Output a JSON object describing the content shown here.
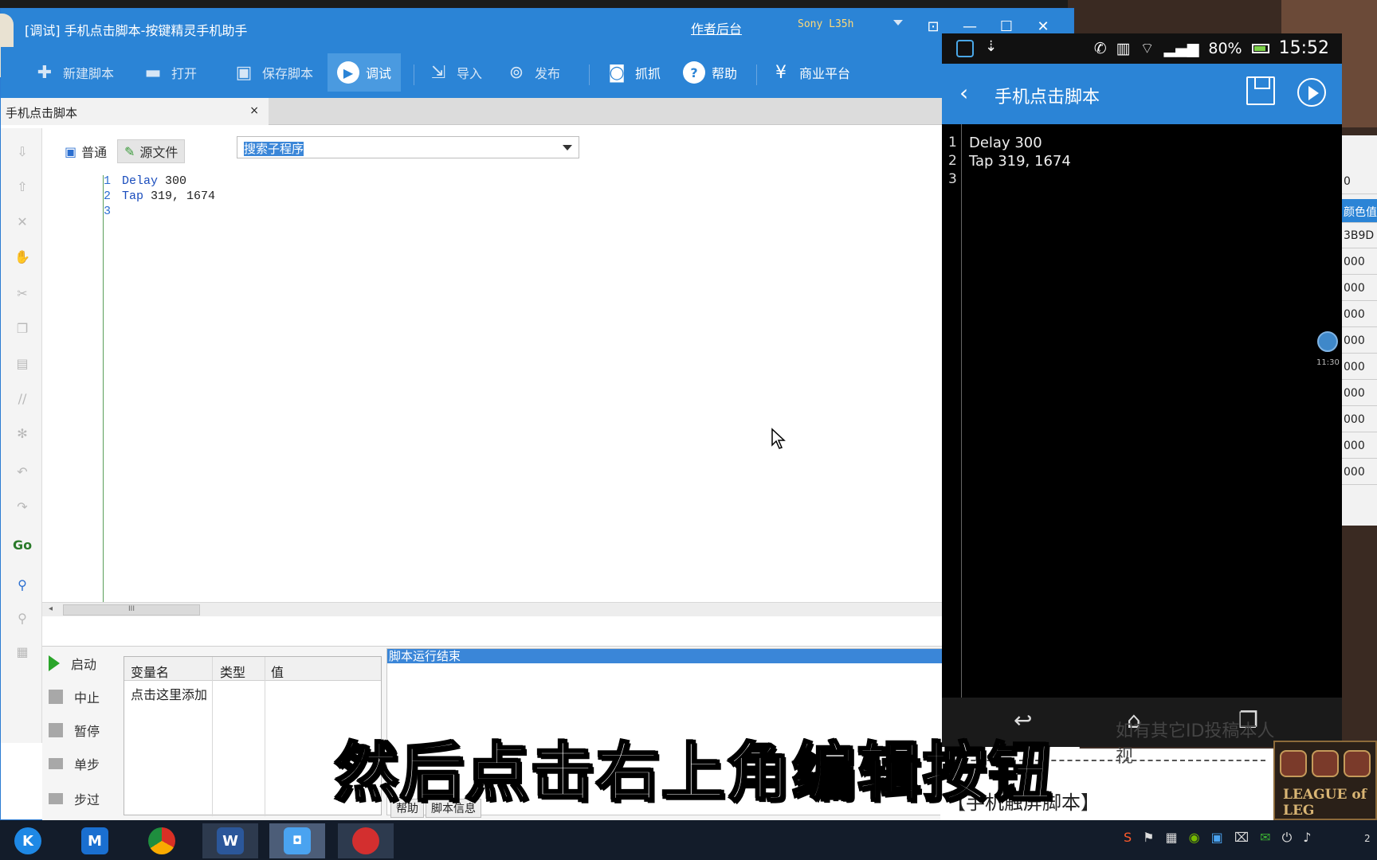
{
  "window": {
    "title": "[调试] 手机点击脚本-按键精灵手机助手",
    "author_link": "作者后台",
    "device": "Sony L35h",
    "controls": {
      "menu": "⊡",
      "minimize": "—",
      "maximize": "☐",
      "close": "✕"
    }
  },
  "toolbar": {
    "new_script": "新建脚本",
    "open": "打开",
    "save_script": "保存脚本",
    "debug": "调试",
    "import": "导入",
    "publish": "发布",
    "capture": "抓抓",
    "help": "帮助",
    "business": "商业平台"
  },
  "tab": {
    "label": "手机点击脚本",
    "close": "×"
  },
  "editor": {
    "mode_normal": "普通",
    "mode_source": "源文件",
    "search_placeholder": "搜索子程序",
    "line_numbers": "1\n2\n3",
    "code_line1_kw": "Delay",
    "code_line1_arg": " 300",
    "code_line2_kw": "Tap",
    "code_line2_arg": " 319, 1674",
    "scroll_thumb": "III"
  },
  "run_controls": {
    "start": "启动",
    "stop": "中止",
    "pause": "暂停",
    "step": "单步",
    "step_over": "步过"
  },
  "variables": {
    "col_name": "变量名",
    "col_type": "类型",
    "col_value": "值",
    "add_row": "点击这里添加"
  },
  "log": {
    "line": "脚本运行结束",
    "tab_help": "帮助",
    "tab_info": "脚本信息"
  },
  "phone": {
    "battery": "80%",
    "time": "15:52",
    "title": "手机点击脚本",
    "line_numbers": "1\n2\n3",
    "code": "Delay 300\nTap 319, 1674",
    "float_time": "11:30"
  },
  "right_strip": {
    "cells": [
      "0",
      "颜色值",
      "3B9D",
      "000",
      "000",
      "000",
      "000",
      "000",
      "000",
      "000",
      "000",
      "000"
    ]
  },
  "background_doc": {
    "line1": "如有其它ID投稿本人视",
    "line2": "【手机触屏脚本】",
    "badge": "LEAGUE of LEG"
  },
  "subtitle": "然后点击右上角编辑按钮",
  "taskbar": {
    "apps": [
      "K",
      "M",
      "Chrome",
      "W",
      "按键精灵",
      "录屏"
    ],
    "clock": "2"
  },
  "colors": {
    "accent": "#2b84d6",
    "subtitle": "#ffffff"
  }
}
